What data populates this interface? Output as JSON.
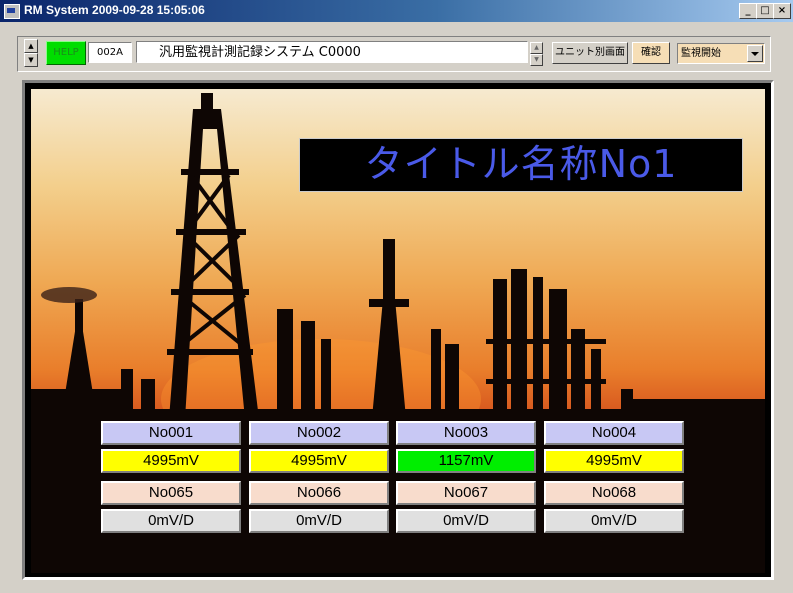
{
  "window": {
    "title": "RM System   2009-09-28 15:05:06"
  },
  "toolbar": {
    "help_label": "HELP",
    "code": "002A",
    "system_title": "汎用監視計測記録システム  C0000",
    "unit_screen_label": "ユニット別画面",
    "confirm_label": "確認",
    "mode_select_value": "監視開始"
  },
  "display": {
    "title": "タイトル名称No1"
  },
  "channels_row1": [
    {
      "name": "No001",
      "value": "4995mV",
      "status_color": "#ffff00"
    },
    {
      "name": "No002",
      "value": "4995mV",
      "status_color": "#ffff00"
    },
    {
      "name": "No003",
      "value": "1157mV",
      "status_color": "#00ee00"
    },
    {
      "name": "No004",
      "value": "4995mV",
      "status_color": "#ffff00"
    }
  ],
  "channels_row2": [
    {
      "name": "No065",
      "value": "0mV/D",
      "status_color": "#e0e0e0"
    },
    {
      "name": "No066",
      "value": "0mV/D",
      "status_color": "#e0e0e0"
    },
    {
      "name": "No067",
      "value": "0mV/D",
      "status_color": "#e0e0e0"
    },
    {
      "name": "No068",
      "value": "0mV/D",
      "status_color": "#e0e0e0"
    }
  ],
  "colors": {
    "row1_name_bg": "#c8c8f4",
    "row2_name_bg": "#f8dccc",
    "title_text": "#4a5ae8"
  },
  "icons": [
    "app-icon",
    "minimize-icon",
    "maximize-icon",
    "close-icon",
    "spin-up-icon",
    "spin-down-icon",
    "dropdown-arrow-icon"
  ]
}
